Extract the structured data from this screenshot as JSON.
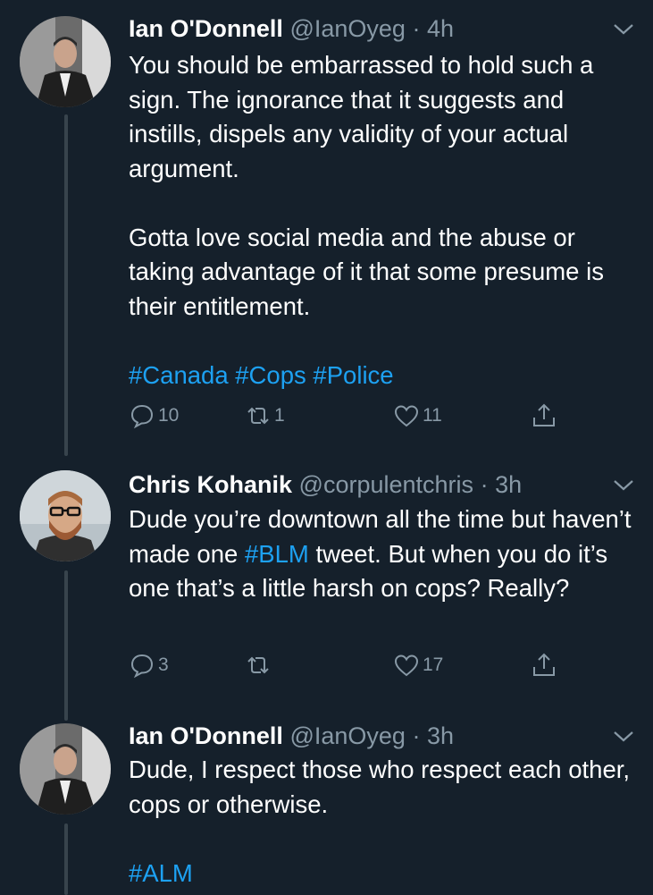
{
  "tweets": [
    {
      "name": "Ian O'Donnell",
      "handle": "@IanOyeg",
      "sep": "·",
      "time": "4h",
      "paragraphs": [
        "You should be embarrassed to hold such a sign. The ignorance that it suggests and instills, dispels any validity of your actual argument.",
        "Gotta love social media and the abuse or taking advantage of it that some presume is their entitlement."
      ],
      "hashtags": [
        "#Canada",
        "#Cops",
        "#Police"
      ],
      "replies": "10",
      "retweets": "1",
      "likes": "11"
    },
    {
      "name": "Chris Kohanik",
      "handle": "@corpulentchris",
      "sep": "·",
      "time": "3h",
      "text_before": "Dude you’re downtown all the time but haven’t made one ",
      "hashtag": "#BLM",
      "text_after": " tweet. But when you do it’s one that’s a little harsh on cops? Really?",
      "replies": "3",
      "retweets": "",
      "likes": "17"
    },
    {
      "name": "Ian O'Donnell",
      "handle": "@IanOyeg",
      "sep": "·",
      "time": "3h",
      "paragraphs": [
        "Dude, I respect those who respect each other, cops or otherwise."
      ],
      "hashtags": [
        "#ALM"
      ]
    }
  ],
  "icons": {
    "reply": "reply-icon",
    "retweet": "retweet-icon",
    "like": "heart-icon",
    "share": "share-icon",
    "more": "chevron-down-icon"
  },
  "colors": {
    "background": "#15202b",
    "link": "#1da1f2",
    "muted": "#8899a6",
    "thread": "#38444d"
  }
}
